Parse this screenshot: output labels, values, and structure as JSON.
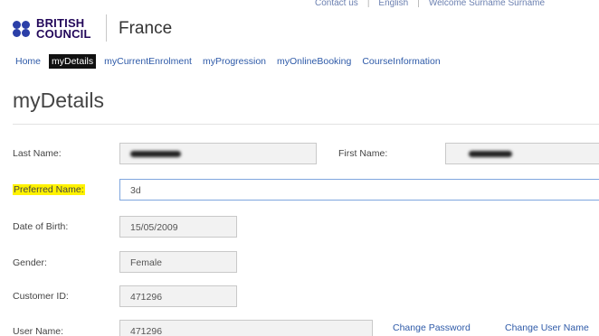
{
  "header": {
    "top_links": [
      "Contact us",
      "English",
      "Welcome Surname Surname"
    ],
    "brand_line1": "BRITISH",
    "brand_line2": "COUNCIL",
    "country": "France"
  },
  "nav": {
    "items": [
      "Home",
      "myDetails",
      "myCurrentEnrolment",
      "myProgression",
      "myOnlineBooking",
      "CourseInformation"
    ],
    "active": "myDetails"
  },
  "page": {
    "title": "myDetails"
  },
  "form": {
    "last_name_label": "Last Name:",
    "first_name_label": "First Name:",
    "preferred_name_label": "Preferred Name:",
    "preferred_name_value": "3d",
    "dob_label": "Date of Birth:",
    "dob_value": "15/05/2009",
    "gender_label": "Gender:",
    "gender_value": "Female",
    "customer_id_label": "Customer ID:",
    "customer_id_value": "471296",
    "user_name_label": "User Name:",
    "user_name_value": "471296",
    "change_password": "Change Password",
    "change_user_name": "Change User Name"
  },
  "colors": {
    "brand": "#23085a",
    "link": "#2e5aa8",
    "highlight": "#fff200",
    "nav_active_bg": "#111111"
  }
}
